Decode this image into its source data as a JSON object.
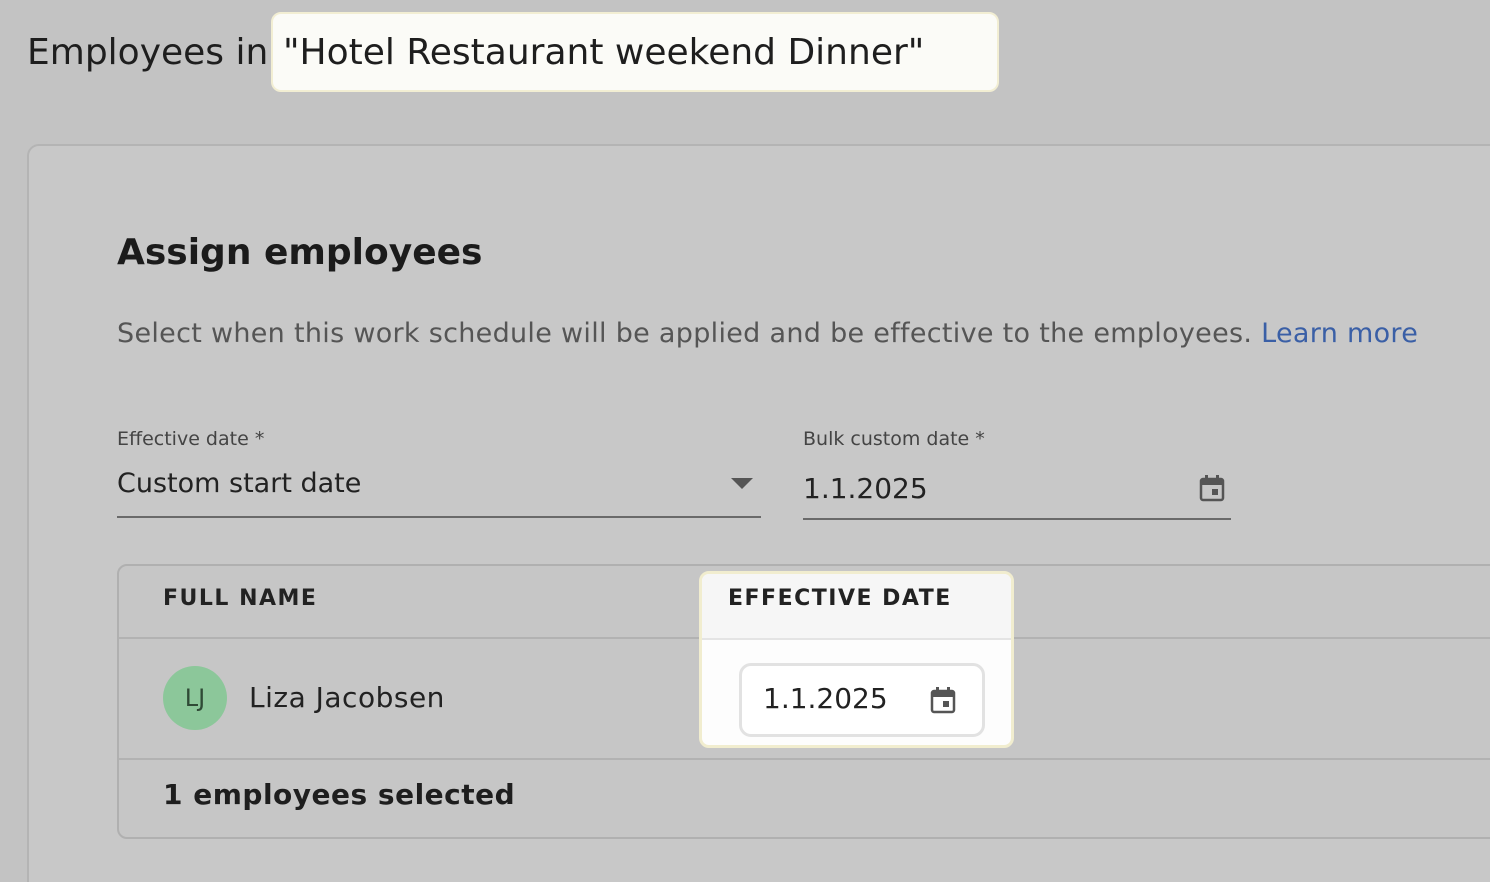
{
  "header": {
    "title_prefix": "Employees in",
    "schedule_name": "\"Hotel Restaurant weekend Dinner\""
  },
  "assign": {
    "title": "Assign employees",
    "description": "Select when this work schedule will be applied and be effective to the employees.",
    "learn_more": "Learn more"
  },
  "effective_date": {
    "label": "Effective date *",
    "value": "Custom start date",
    "icon": "chevron-down-icon"
  },
  "bulk_date": {
    "label": "Bulk custom date *",
    "value": "1.1.2025",
    "icon": "calendar-icon"
  },
  "table": {
    "columns": [
      "FULL NAME",
      "EFFECTIVE DATE"
    ],
    "rows": [
      {
        "initials": "LJ",
        "name": "Liza Jacobsen",
        "effective_date": "1.1.2025",
        "avatar_color": "#8cc79a"
      }
    ],
    "footer": "1 employees selected"
  },
  "colors": {
    "link": "#3a5fa6",
    "background": "#c3c3c3",
    "highlight": "#fdfdfd"
  }
}
